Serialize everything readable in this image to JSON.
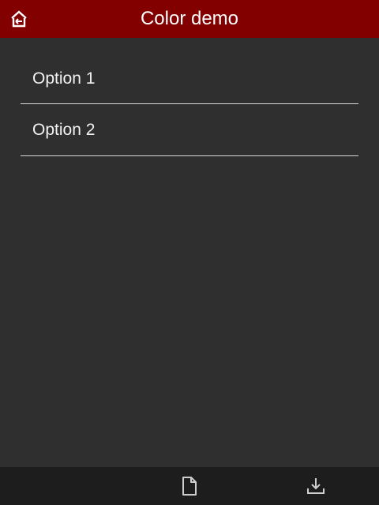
{
  "titlebar": {
    "title": "Color demo",
    "home_icon": "home-back-icon",
    "color": "#820000"
  },
  "list": {
    "items": [
      {
        "label": "Option 1"
      },
      {
        "label": "Option 2"
      }
    ]
  },
  "bottombar": {
    "icons": [
      "file-icon",
      "download-icon"
    ],
    "color": "#1d1d1d"
  },
  "colors": {
    "background": "#2f2f2f",
    "text": "#f2f2f2",
    "divider": "#d8d8d8"
  }
}
